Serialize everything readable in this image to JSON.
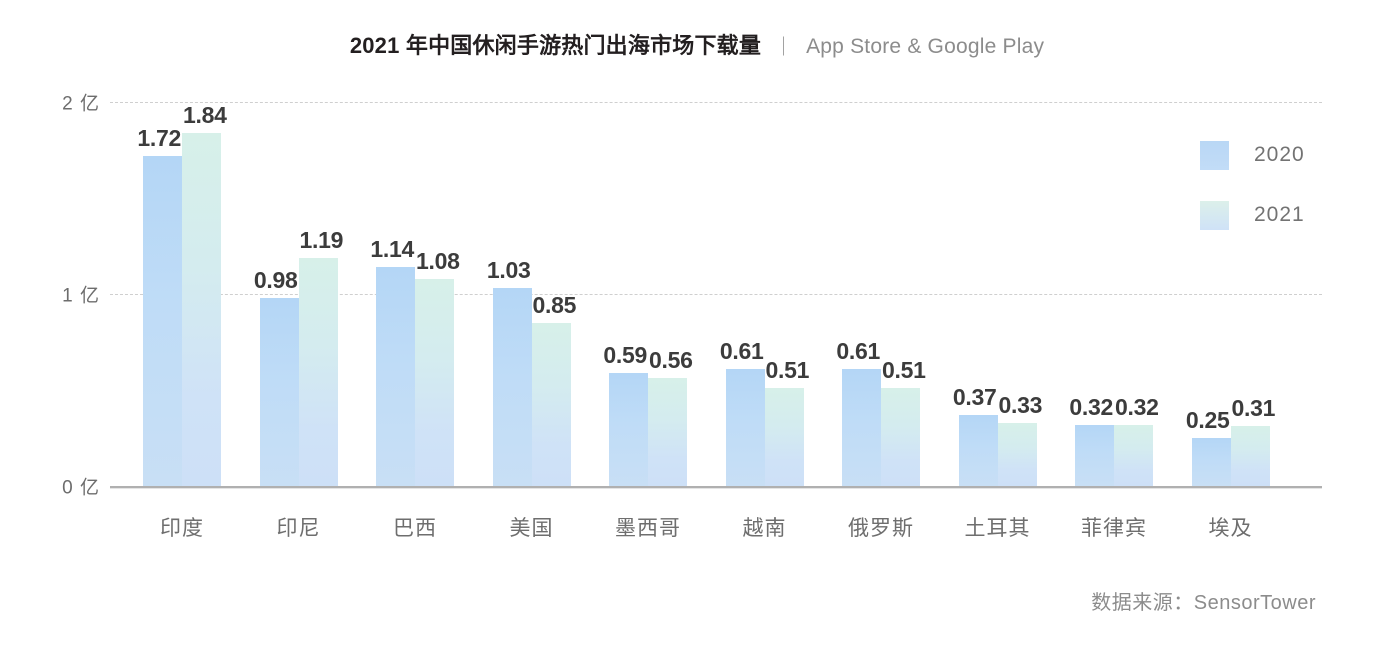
{
  "header": {
    "title_main": "2021 年中国休闲手游热门出海市场下载量",
    "title_separator": "｜",
    "title_sub": "App Store & Google Play"
  },
  "footer": {
    "source": "数据来源：SensorTower"
  },
  "legend": {
    "position": "right",
    "entries": [
      {
        "label": "2020",
        "color": "#b9d7f5"
      },
      {
        "label": "2021",
        "color": "#d7f0e9"
      }
    ]
  },
  "axis": {
    "y_ticks": [
      "0 亿",
      "1 亿",
      "2 亿"
    ],
    "y_values": [
      0,
      1,
      2
    ]
  },
  "chart_data": {
    "type": "bar",
    "title": "2021 年中国休闲手游热门出海市场下载量 ｜ App Store & Google Play",
    "xlabel": "",
    "ylabel": "亿",
    "ylim": [
      0,
      2
    ],
    "grid": true,
    "legend_position": "right",
    "categories": [
      "印度",
      "印尼",
      "巴西",
      "美国",
      "墨西哥",
      "越南",
      "俄罗斯",
      "土耳其",
      "菲律宾",
      "埃及"
    ],
    "series": [
      {
        "name": "2020",
        "color": "#b9d7f5",
        "values": [
          1.72,
          0.98,
          1.14,
          1.03,
          0.59,
          0.61,
          0.61,
          0.37,
          0.32,
          0.25
        ],
        "labels": [
          "1.72",
          "0.98",
          "1.14",
          "1.03",
          "0.59",
          "0.61",
          "0.61",
          "0.37",
          "0.32",
          "0.25"
        ]
      },
      {
        "name": "2021",
        "color": "#d7f0e9",
        "values": [
          1.84,
          1.19,
          1.08,
          0.85,
          0.56,
          0.51,
          0.51,
          0.33,
          0.32,
          0.31
        ],
        "labels": [
          "1.84",
          "1.19",
          "1.08",
          "0.85",
          "0.56",
          "0.51",
          "0.51",
          "0.33",
          "0.32",
          "0.31"
        ]
      }
    ],
    "units": "亿 (hundred million downloads)"
  }
}
